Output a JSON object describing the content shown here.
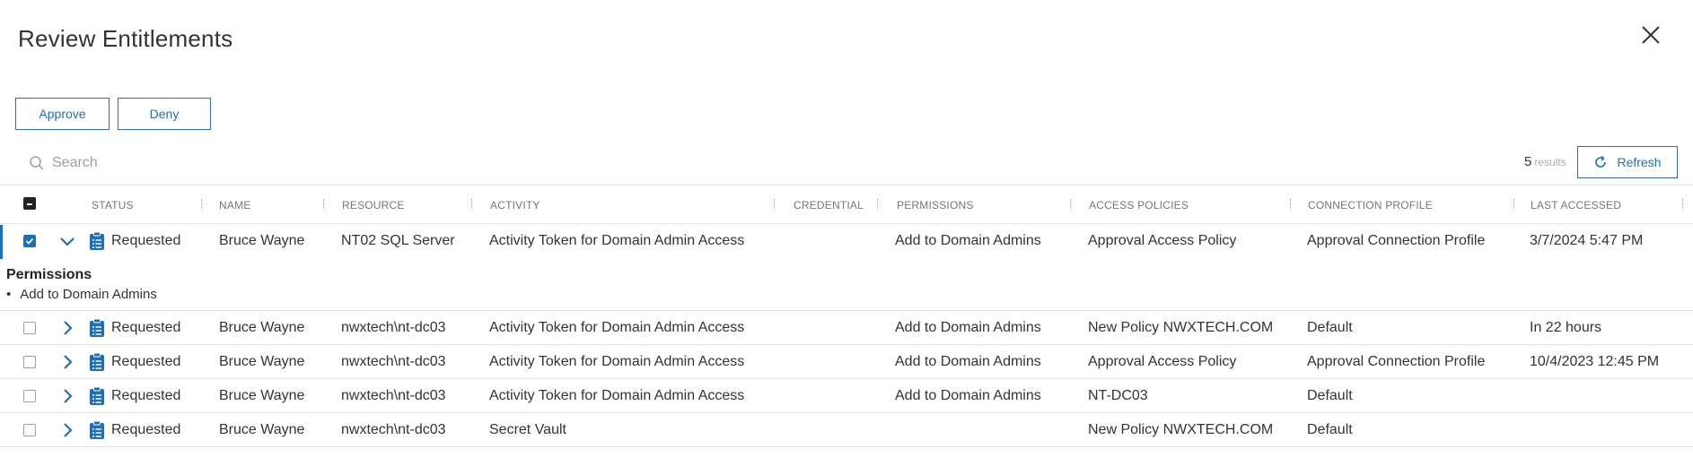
{
  "dialog": {
    "title": "Review Entitlements"
  },
  "toolbar": {
    "approve_label": "Approve",
    "deny_label": "Deny"
  },
  "search": {
    "placeholder": "Search"
  },
  "results": {
    "count": "5",
    "label": "results"
  },
  "refresh": {
    "label": "Refresh"
  },
  "colors": {
    "accent": "#1f6fb5",
    "divider": "#e3e3e3",
    "header_text": "#777777"
  },
  "columns": [
    "STATUS",
    "NAME",
    "RESOURCE",
    "ACTIVITY",
    "CREDENTIAL",
    "PERMISSIONS",
    "ACCESS POLICIES",
    "CONNECTION PROFILE",
    "LAST ACCESSED"
  ],
  "rows": [
    {
      "checked": true,
      "expanded": true,
      "status_icon": "clipboard-list-icon",
      "status": "Requested",
      "name": "Bruce Wayne",
      "resource": "NT02 SQL Server",
      "activity": "Activity Token for Domain Admin Access",
      "credential": "",
      "permissions": "Add to Domain Admins",
      "access_policy": "Approval Access Policy",
      "connection_profile": "Approval Connection Profile",
      "last_accessed": "3/7/2024 5:47 PM"
    },
    {
      "checked": false,
      "expanded": false,
      "status_icon": "clipboard-list-icon",
      "status": "Requested",
      "name": "Bruce Wayne",
      "resource": "nwxtech\\nt-dc03",
      "activity": "Activity Token for Domain Admin Access",
      "credential": "",
      "permissions": "Add to Domain Admins",
      "access_policy": "New Policy NWXTECH.COM",
      "connection_profile": "Default",
      "last_accessed": "In 22 hours"
    },
    {
      "checked": false,
      "expanded": false,
      "status_icon": "clipboard-list-icon",
      "status": "Requested",
      "name": "Bruce Wayne",
      "resource": "nwxtech\\nt-dc03",
      "activity": "Activity Token for Domain Admin Access",
      "credential": "",
      "permissions": "Add to Domain Admins",
      "access_policy": "Approval Access Policy",
      "connection_profile": "Approval Connection Profile",
      "last_accessed": "10/4/2023 12:45 PM"
    },
    {
      "checked": false,
      "expanded": false,
      "status_icon": "clipboard-list-icon",
      "status": "Requested",
      "name": "Bruce Wayne",
      "resource": "nwxtech\\nt-dc03",
      "activity": "Activity Token for Domain Admin Access",
      "credential": "",
      "permissions": "Add to Domain Admins",
      "access_policy": "NT-DC03",
      "connection_profile": "Default",
      "last_accessed": ""
    },
    {
      "checked": false,
      "expanded": false,
      "status_icon": "clipboard-list-icon",
      "status": "Requested",
      "name": "Bruce Wayne",
      "resource": "nwxtech\\nt-dc03",
      "activity": "Secret Vault",
      "credential": "",
      "permissions": "",
      "access_policy": "New Policy NWXTECH.COM",
      "connection_profile": "Default",
      "last_accessed": ""
    }
  ],
  "expanded_detail": {
    "title": "Permissions",
    "items": [
      "Add to Domain Admins"
    ]
  }
}
